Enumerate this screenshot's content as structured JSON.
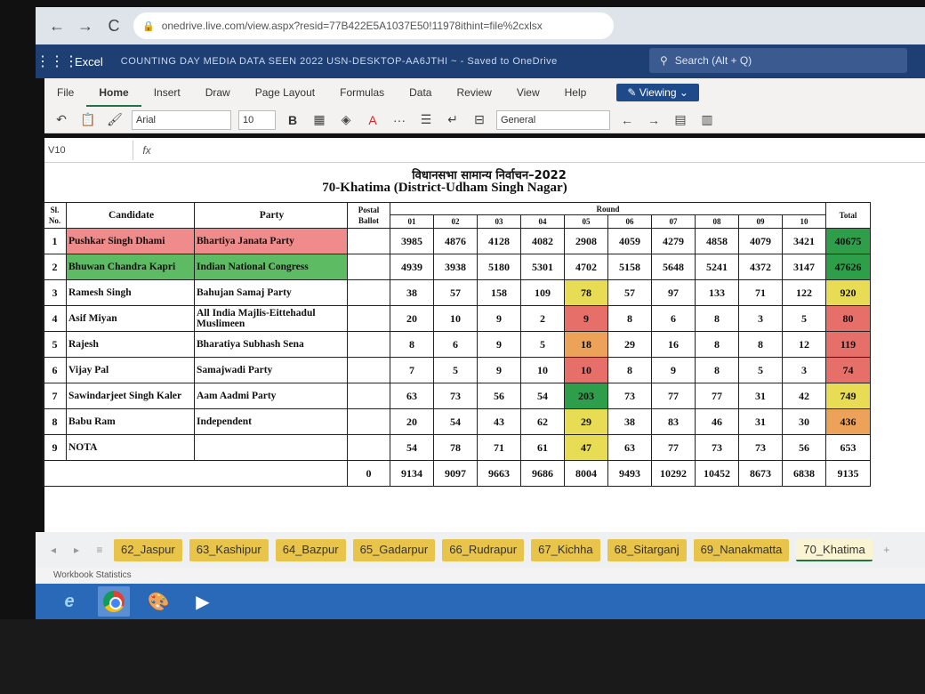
{
  "browser": {
    "url": "onedrive.live.com/view.aspx?resid=77B422E5A1037E50!11978ithint=file%2cxlsx",
    "back": "←",
    "forward": "→",
    "reload": "C"
  },
  "excel": {
    "app_name": "Excel",
    "doc_title": "COUNTING DAY MEDIA DATA SEEN 2022 USN-DESKTOP-AA6JTHI ~ - Saved to OneDrive",
    "search_placeholder": "Search (Alt + Q)"
  },
  "ribbon": {
    "tabs": [
      "File",
      "Home",
      "Insert",
      "Draw",
      "Page Layout",
      "Formulas",
      "Data",
      "Review",
      "View",
      "Help"
    ],
    "viewing_label": "Viewing",
    "font_name": "Arial",
    "font_size": "10",
    "bold_label": "B",
    "number_format": "General"
  },
  "formula_bar": {
    "name_box": "V10",
    "fx": "fx",
    "value": ""
  },
  "sheet": {
    "title_hindi": "विधानसभा सामान्य निर्वाचन–2022",
    "title_english": "70-Khatima (District-Udham Singh Nagar)",
    "headers": {
      "sl": "Sl. No.",
      "candidate": "Candidate",
      "party": "Party",
      "postal": "Postal Ballot",
      "round": "Round",
      "total": "Total",
      "rounds": [
        "01",
        "02",
        "03",
        "04",
        "05",
        "06",
        "07",
        "08",
        "09",
        "10"
      ]
    },
    "rows": [
      {
        "sl": "1",
        "candidate": "Pushkar Singh Dhami",
        "party": "Bhartiya Janata Party",
        "postal": "",
        "rounds": [
          "3985",
          "4876",
          "4128",
          "4082",
          "2908",
          "4059",
          "4279",
          "4858",
          "4079",
          "3421"
        ],
        "total": "40675"
      },
      {
        "sl": "2",
        "candidate": "Bhuwan Chandra Kapri",
        "party": "Indian National Congress",
        "postal": "",
        "rounds": [
          "4939",
          "3938",
          "5180",
          "5301",
          "4702",
          "5158",
          "5648",
          "5241",
          "4372",
          "3147"
        ],
        "total": "47626"
      },
      {
        "sl": "3",
        "candidate": "Ramesh Singh",
        "party": "Bahujan Samaj Party",
        "postal": "",
        "rounds": [
          "38",
          "57",
          "158",
          "109",
          "78",
          "57",
          "97",
          "133",
          "71",
          "122"
        ],
        "total": "920"
      },
      {
        "sl": "4",
        "candidate": "Asif Miyan",
        "party": "All India Majlis-Eittehadul Muslimeen",
        "postal": "",
        "rounds": [
          "20",
          "10",
          "9",
          "2",
          "9",
          "8",
          "6",
          "8",
          "3",
          "5"
        ],
        "total": "80"
      },
      {
        "sl": "5",
        "candidate": "Rajesh",
        "party": "Bharatiya Subhash Sena",
        "postal": "",
        "rounds": [
          "8",
          "6",
          "9",
          "5",
          "18",
          "29",
          "16",
          "8",
          "8",
          "12"
        ],
        "total": "119"
      },
      {
        "sl": "6",
        "candidate": "Vijay Pal",
        "party": "Samajwadi Party",
        "postal": "",
        "rounds": [
          "7",
          "5",
          "9",
          "10",
          "10",
          "8",
          "9",
          "8",
          "5",
          "3"
        ],
        "total": "74"
      },
      {
        "sl": "7",
        "candidate": "Sawindarjeet Singh Kaler",
        "party": "Aam Aadmi Party",
        "postal": "",
        "rounds": [
          "63",
          "73",
          "56",
          "54",
          "203",
          "73",
          "77",
          "77",
          "31",
          "42"
        ],
        "total": "749"
      },
      {
        "sl": "8",
        "candidate": "Babu Ram",
        "party": "Independent",
        "postal": "",
        "rounds": [
          "20",
          "54",
          "43",
          "62",
          "29",
          "38",
          "83",
          "46",
          "31",
          "30"
        ],
        "total": "436"
      },
      {
        "sl": "9",
        "candidate": "NOTA",
        "party": "",
        "postal": "",
        "rounds": [
          "54",
          "78",
          "71",
          "61",
          "47",
          "63",
          "77",
          "73",
          "73",
          "56"
        ],
        "total": "653"
      }
    ],
    "totals": {
      "postal": "0",
      "rounds": [
        "9134",
        "9097",
        "9663",
        "9686",
        "8004",
        "9493",
        "10292",
        "10452",
        "8673",
        "6838"
      ],
      "total": "9135"
    }
  },
  "sheet_tabs": {
    "items": [
      "62_Jaspur",
      "63_Kashipur",
      "64_Bazpur",
      "65_Gadarpur",
      "66_Rudrapur",
      "67_Kichha",
      "68_Sitarganj",
      "69_Nanakmatta",
      "70_Khatima"
    ],
    "active": "70_Khatima"
  },
  "status_bar": {
    "label": "Workbook Statistics"
  },
  "colors": {
    "excel_blue": "#1e3f74",
    "excel_green": "#217346",
    "tab_yellow": "#e8c44a",
    "highlight_red": "#e76f6a",
    "highlight_green": "#5dbb63",
    "highlight_yellow": "#e8dc54",
    "highlight_orange": "#eda25a"
  },
  "icons": {
    "back": "arrow-left-icon",
    "forward": "arrow-right-icon",
    "reload": "reload-icon",
    "lock": "lock-icon",
    "waffle": "app-launcher-icon",
    "search": "search-icon"
  }
}
